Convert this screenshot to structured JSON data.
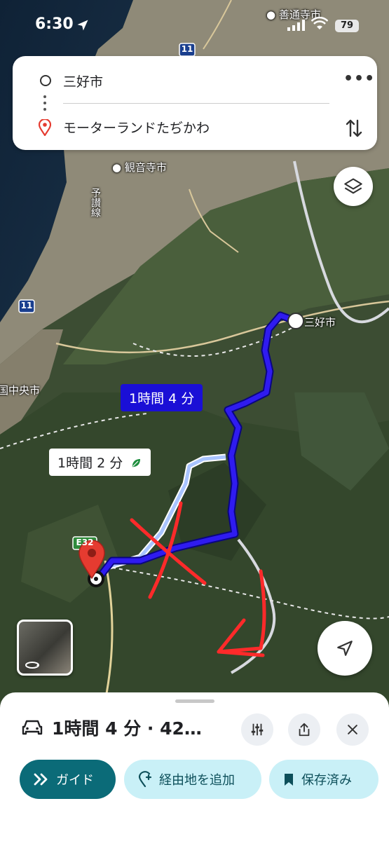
{
  "status_bar": {
    "time": "6:30",
    "battery": "79"
  },
  "search": {
    "origin": "三好市",
    "destination": "モーターランドたぢかわ"
  },
  "map": {
    "places": [
      {
        "key": "zentsuji",
        "label": "善通寺市"
      },
      {
        "key": "kanonji",
        "label": "観音寺市"
      },
      {
        "key": "miyoshi",
        "label": "三好市"
      },
      {
        "key": "shikokuchuo",
        "label": "四国中央市"
      }
    ],
    "rail_label": "予讃線",
    "road_shields": [
      "11",
      "11",
      "E32"
    ],
    "routes": [
      {
        "label": "1時間 4 分",
        "selected": true,
        "color": "#1a0fd6"
      },
      {
        "label": "1時間 2 分",
        "selected": false,
        "color": "#a9c4ff",
        "eco": true
      }
    ]
  },
  "bottom_sheet": {
    "summary": "1時間 4 分 · 42…",
    "buttons": {
      "guide": "ガイド",
      "add_stop": "経由地を追加",
      "saved": "保存済み"
    }
  },
  "colors": {
    "accent": "#0b6b78",
    "chip": "#c9f0f7",
    "route_primary": "#1a0fd6",
    "route_alt": "#a9c4ff",
    "annotation": "#ff2a2a"
  },
  "icons": [
    "location-arrow-icon",
    "signal-icon",
    "wifi-icon",
    "origin-circle-icon",
    "destination-pin-icon",
    "more-icon",
    "swap-icon",
    "layers-icon",
    "navigate-icon",
    "car-icon",
    "filter-icon",
    "share-icon",
    "close-icon",
    "chevrons-icon",
    "add-stop-icon",
    "bookmark-icon"
  ]
}
